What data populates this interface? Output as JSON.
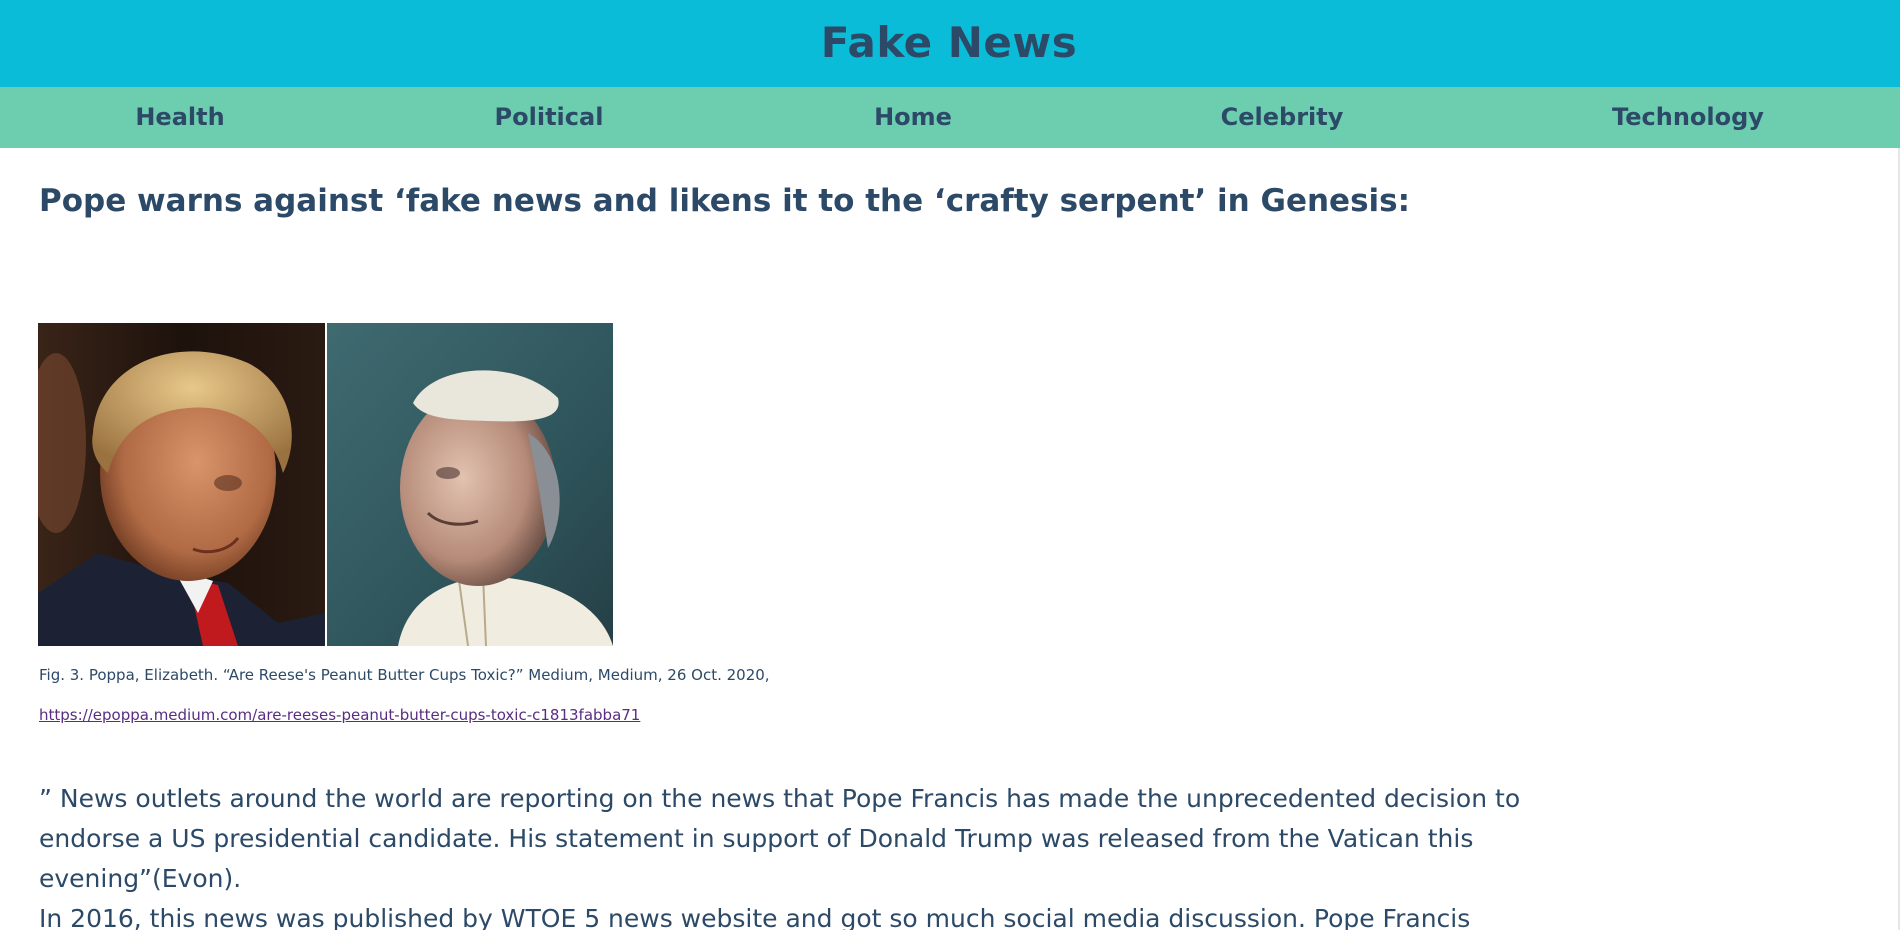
{
  "site": {
    "title": "Fake News"
  },
  "nav": {
    "health": "Health",
    "political": "Political",
    "home": "Home",
    "celebrity": "Celebrity",
    "technology": "Technology"
  },
  "article": {
    "headline": "Pope warns against ‘fake news and likens it to the ‘crafty serpent’ in Genesis:",
    "caption": "Fig. 3. Poppa, Elizabeth. “Are Reese's Peanut Butter Cups Toxic?” Medium, Medium, 26 Oct. 2020,",
    "source_link": "https://epoppa.medium.com/are-reeses-peanut-butter-cups-toxic-c1813fabba71",
    "quote": "” News outlets around the world are reporting on the news that Pope Francis has made the unprecedented decision to endorse a US presidential candidate. His statement in support of Donald Trump was released from the Vatican this evening”(Evon).",
    "paragraph": "In 2016, this news was published by WTOE 5 news website and got so much social media discussion. Pope Francis"
  },
  "colors": {
    "header_bg": "#0bbcd8",
    "nav_bg": "#6dcdaf",
    "text": "#2c4a68",
    "link": "#5a2c82"
  }
}
